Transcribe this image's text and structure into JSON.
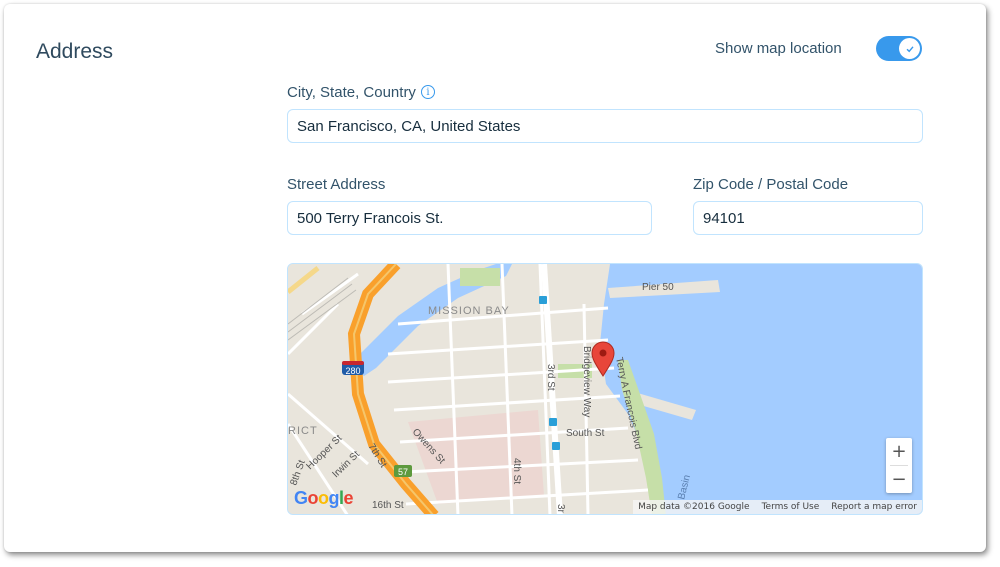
{
  "section": {
    "title": "Address"
  },
  "toggle": {
    "label": "Show map location",
    "on": true
  },
  "city": {
    "label": "City, State, Country",
    "value": "San Francisco, CA, United States"
  },
  "street": {
    "label": "Street Address",
    "value": "500 Terry Francois St."
  },
  "zip": {
    "label": "Zip Code / Postal Code",
    "value": "94101"
  },
  "map": {
    "labels": {
      "pier": "Pier 50",
      "mission_bay": "MISSION BAY",
      "bridgeview": "Bridgeview Way",
      "terry": "Terry A Francois Blvd",
      "third": "3rd St",
      "third_b": "3r",
      "south": "South St",
      "owens": "Owens St",
      "fourth": "4th St",
      "seventh": "7th St",
      "hooper": "Hooper St",
      "irwin": "Irwin St",
      "eighth": "8th St",
      "sixteenth": "16th St",
      "district": "RICT",
      "basin": "Basin",
      "i280": "280",
      "r57": "57"
    },
    "zoom_in": "+",
    "zoom_out": "−",
    "attribution": {
      "data": "Map data ©2016 Google",
      "terms": "Terms of Use",
      "report": "Report a map error"
    },
    "logo": {
      "g1": "G",
      "o1": "o",
      "o2": "o",
      "g2": "g",
      "l": "l",
      "e": "e"
    },
    "colors": {
      "water": "#a3ccff",
      "land": "#e9e5dc",
      "park": "#c6dfa8",
      "highway": "#f9a02c",
      "marker": "#e8463a"
    }
  }
}
